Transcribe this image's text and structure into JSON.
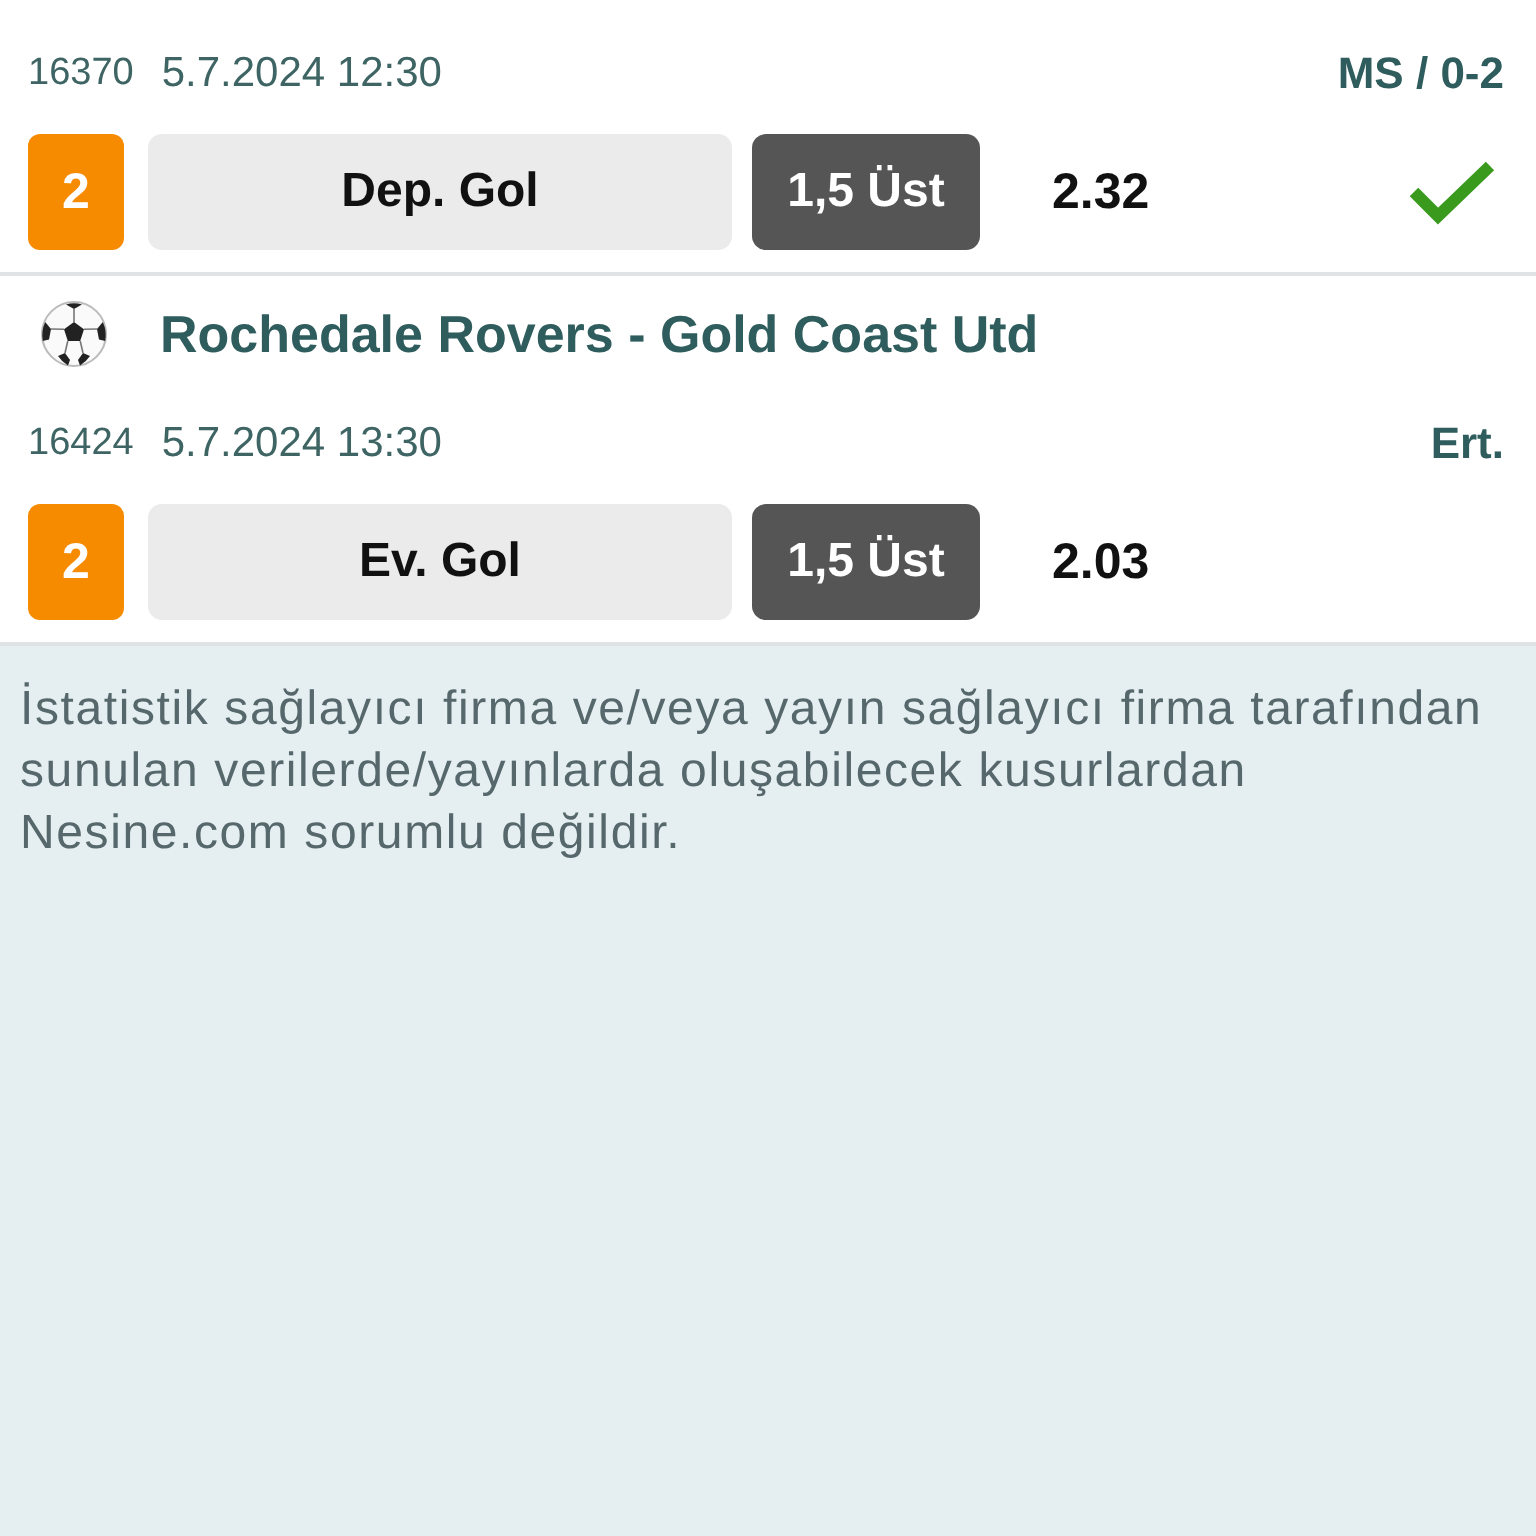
{
  "matches": [
    {
      "code": "16370",
      "datetime": "5.7.2024 12:30",
      "result": "MS / 0-2",
      "picks": [
        {
          "number": "2",
          "market": "Dep. Gol",
          "selection": "1,5 Üst",
          "odds": "2.32",
          "won": true
        }
      ]
    },
    {
      "title": "Rochedale Rovers - Gold Coast Utd",
      "code": "16424",
      "datetime": "5.7.2024 13:30",
      "result": "Ert.",
      "picks": [
        {
          "number": "2",
          "market": "Ev. Gol",
          "selection": "1,5 Üst",
          "odds": "2.03",
          "won": false
        }
      ]
    }
  ],
  "disclaimer": "İstatistik sağlayıcı firma ve/veya yayın sağlayıcı firma tarafından sunulan verilerde/yayınlarda oluşabilecek kusurlardan Nesine.com sorumlu değildir."
}
